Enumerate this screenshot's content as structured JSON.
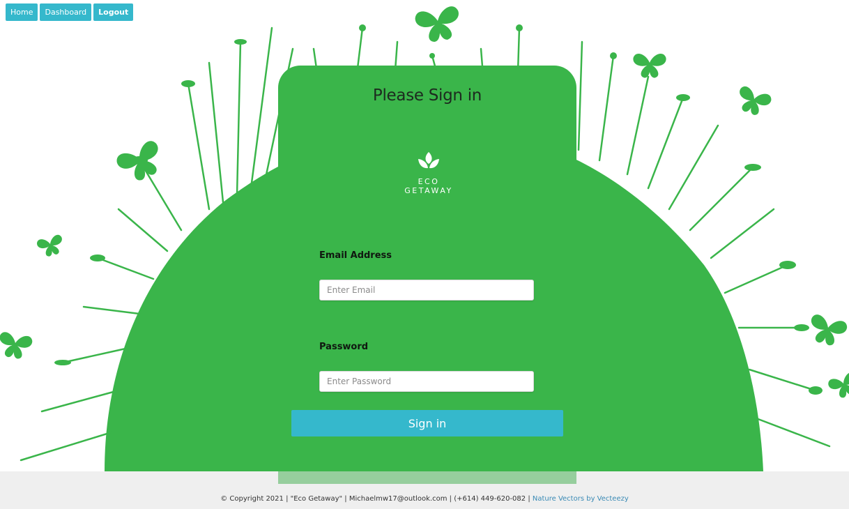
{
  "nav": {
    "home_label": "Home",
    "dashboard_label": "Dashboard",
    "logout_label": "Logout"
  },
  "card": {
    "title": "Please Sign in",
    "logo_line1": "ECO",
    "logo_line2": "GETAWAY",
    "email_label": "Email Address",
    "email_placeholder": "Enter Email",
    "email_value": "",
    "password_label": "Password",
    "password_placeholder": "Enter Password",
    "password_value": "",
    "signin_label": "Sign in"
  },
  "footer": {
    "text": "© Copyright 2021 | \"Eco Getaway\" | Michaelmw17@outlook.com | (+614) 449-620-082 | ",
    "link_label": "Nature Vectors by Vecteezy"
  },
  "colors": {
    "accent": "#35b8cc",
    "green": "#3ab54a",
    "footer_link": "#3a8ab5"
  },
  "icons": [
    "butterfly-icon",
    "leaf-logo-icon",
    "grass-silhouette"
  ]
}
